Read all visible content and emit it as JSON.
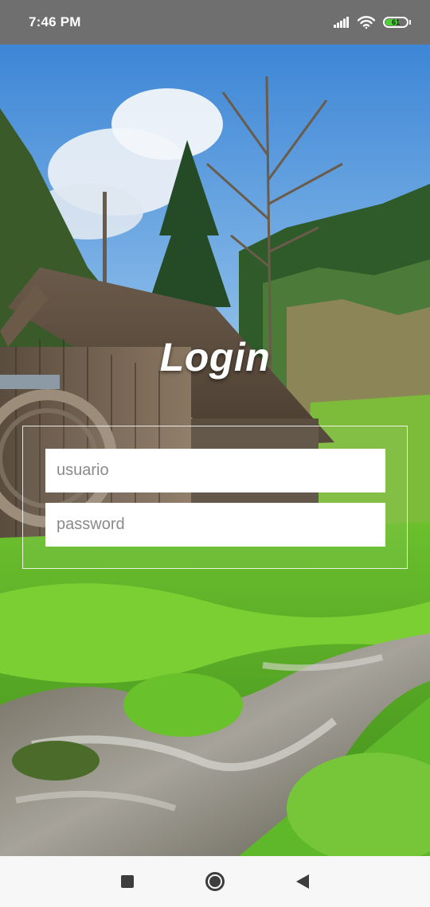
{
  "status_bar": {
    "time": "7:46 PM",
    "battery_level": "61",
    "icons": [
      "signal-icon",
      "wifi-icon",
      "battery-icon"
    ]
  },
  "login": {
    "title": "Login",
    "username_placeholder": "usuario",
    "password_placeholder": "password"
  },
  "nav_bar": {
    "icons": [
      "recents-icon",
      "home-icon",
      "back-icon"
    ]
  },
  "colors": {
    "status_bar_bg": "#6f6f6f",
    "battery_fill": "#4cd137",
    "nav_bar_bg": "#f7f7f7",
    "title_text": "#ffffff"
  }
}
